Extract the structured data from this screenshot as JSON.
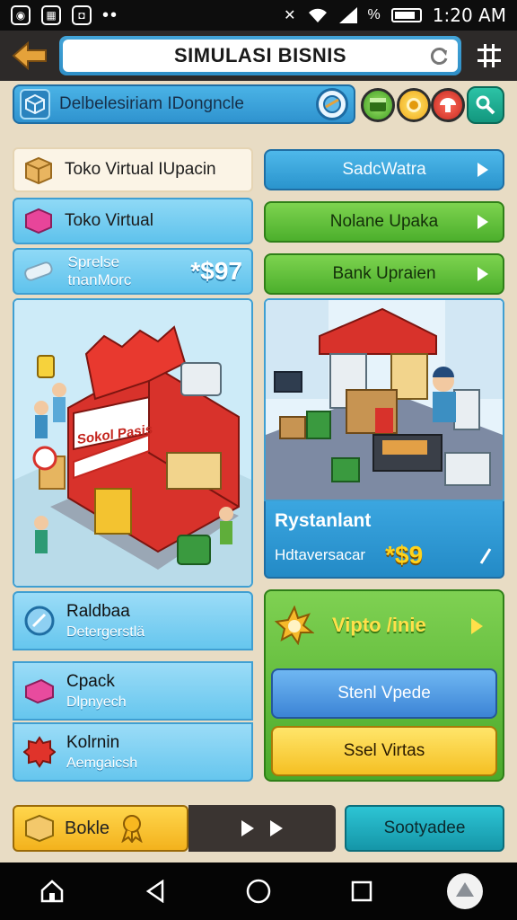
{
  "status_bar": {
    "time": "1:20 AM",
    "percent": "%"
  },
  "header": {
    "title": "SIMULASI BISNIS"
  },
  "sub_bar": {
    "title": "Delbelesiriam IDongncle"
  },
  "left": {
    "row1_label": "Toko Virtual IUpacin",
    "row2_label": "Toko Virtual",
    "row3_label": "Sprelse tnanMorc",
    "row3_price": "*$97",
    "store_sign": "Sokol Pasis",
    "items": [
      {
        "title": "Raldbaa",
        "sub": "Detergerstlä"
      },
      {
        "title": "Cpack",
        "sub": "Dlpnyech"
      },
      {
        "title": "Kolrnin",
        "sub": "Aemgaicsh"
      }
    ]
  },
  "right": {
    "btn1": "SadcWatra",
    "btn2": "Nolane Upaka",
    "btn3": "Bank Upraien",
    "card_title": "Rystanlant",
    "card_sub": "Hdtaversacar",
    "card_price": "*$9",
    "green_title": "Vipto /inie",
    "green_btn1": "Stenl Vpede",
    "green_btn2": "Ssel Virtas"
  },
  "bottom": {
    "left_label": "Bokle",
    "right_label": "Sootyadee"
  },
  "colors": {
    "accent_blue": "#2f93cf",
    "accent_green": "#4caf2c",
    "accent_yellow": "#f5c023",
    "store_red": "#d8322b"
  }
}
